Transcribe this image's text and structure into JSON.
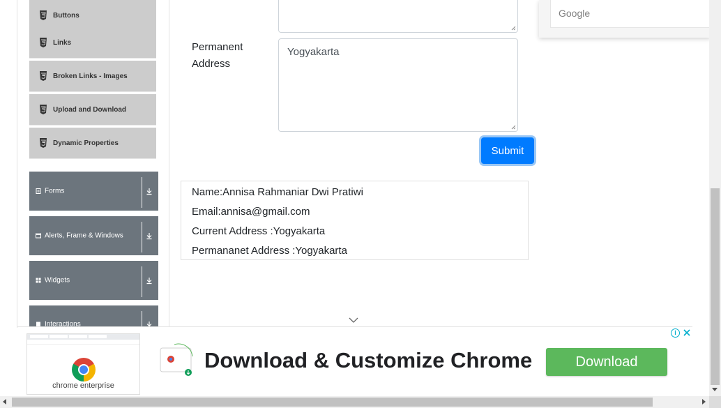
{
  "sidebar": {
    "elements_items": [
      {
        "label": "Buttons"
      },
      {
        "label": "Links"
      },
      {
        "label": "Broken Links - Images"
      },
      {
        "label": "Upload and Download"
      },
      {
        "label": "Dynamic Properties"
      }
    ],
    "groups": [
      {
        "label": "Forms",
        "icon": "document-icon"
      },
      {
        "label": "Alerts, Frame & Windows",
        "icon": "window-icon"
      },
      {
        "label": "Widgets",
        "icon": "grid-icon"
      },
      {
        "label": "Interactions",
        "icon": "document-icon"
      }
    ]
  },
  "form": {
    "permanent_address_label": "Permanent Address",
    "permanent_address_value": "Yogyakarta",
    "submit_label": "Submit"
  },
  "output": {
    "name": "Name:Annisa Rahmaniar Dwi Pratiwi",
    "email": "Email:annisa@gmail.com",
    "current_address": "Current Address :Yogyakarta",
    "permanent_address": "Permananet Address :Yogyakarta"
  },
  "google_card": {
    "text": "Google"
  },
  "ad": {
    "caption": "chrome enterprise",
    "headline": "Download & Customize Chrome",
    "cta": "Download",
    "info": "i"
  },
  "colors": {
    "sidebar_item_bg": "#cccccc",
    "group_bg": "#6c757d",
    "primary": "#007bff",
    "cta_green": "#5cb85c"
  }
}
